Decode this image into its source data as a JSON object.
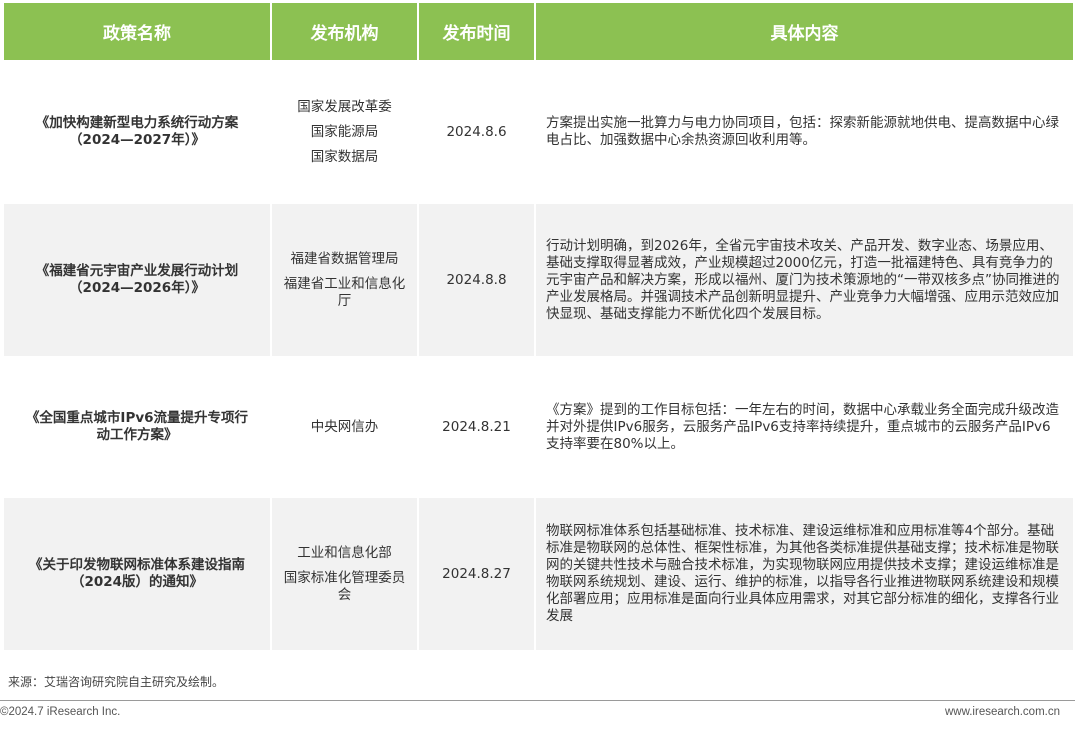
{
  "headers": [
    "政策名称",
    "发布机构",
    "发布时间",
    "具体内容"
  ],
  "rows": [
    {
      "name_lines": [
        "《加快构建新型电力系统行动方案",
        "（2024—2027年）》"
      ],
      "orgs": [
        "国家发展改革委",
        "国家能源局",
        "国家数据局"
      ],
      "date": "2024.8.6",
      "content": "方案提出实施一批算力与电力协同项目，包括：探索新能源就地供电、提高数据中心绿电占比、加强数据中心余热资源回收利用等。"
    },
    {
      "name_lines": [
        "《福建省元宇宙产业发展行动计划",
        "（2024—2026年）》"
      ],
      "orgs": [
        "福建省数据管理局",
        "福建省工业和信息化厅"
      ],
      "date": "2024.8.8",
      "content": "行动计划明确，到2026年，全省元宇宙技术攻关、产品开发、数字业态、场景应用、基础支撑取得显著成效，产业规模超过2000亿元，打造一批福建特色、具有竞争力的元宇宙产品和解决方案，形成以福州、厦门为技术策源地的“一带双核多点”协同推进的产业发展格局。并强调技术产品创新明显提升、产业竞争力大幅增强、应用示范效应加快显现、基础支撑能力不断优化四个发展目标。"
    },
    {
      "name_lines": [
        "《全国重点城市IPv6流量提升专项行",
        "动工作方案》"
      ],
      "orgs": [
        "中央网信办"
      ],
      "date": "2024.8.21",
      "content": "《方案》提到的工作目标包括：一年左右的时间，数据中心承载业务全面完成升级改造并对外提供IPv6服务，云服务产品IPv6支持率持续提升，重点城市的云服务产品IPv6支持率要在80%以上。"
    },
    {
      "name_lines": [
        "《关于印发物联网标准体系建设指南",
        "（2024版）的通知》"
      ],
      "orgs": [
        "工业和信息化部",
        "国家标准化管理委员会"
      ],
      "date": "2024.8.27",
      "content": "物联网标准体系包括基础标准、技术标准、建设运维标准和应用标准等4个部分。基础标准是物联网的总体性、框架性标准，为其他各类标准提供基础支撑；技术标准是物联网的关键共性技术与融合技术标准，为实现物联网应用提供技术支撑；建设运维标准是物联网系统规划、建设、运行、维护的标准，以指导各行业推进物联网系统建设和规模化部署应用；应用标准是面向行业具体应用需求，对其它部分标准的细化，支撑各行业发展"
    }
  ],
  "source": "来源：艾瑞咨询研究院自主研究及绘制。",
  "copyright": "©2024.7 iResearch Inc.",
  "website": "www.iresearch.com.cn",
  "colors": {
    "header_bg": "#8cc152",
    "header_text": "#ffffff",
    "alt_row_bg": "#f2f2f2",
    "text": "#333333"
  }
}
